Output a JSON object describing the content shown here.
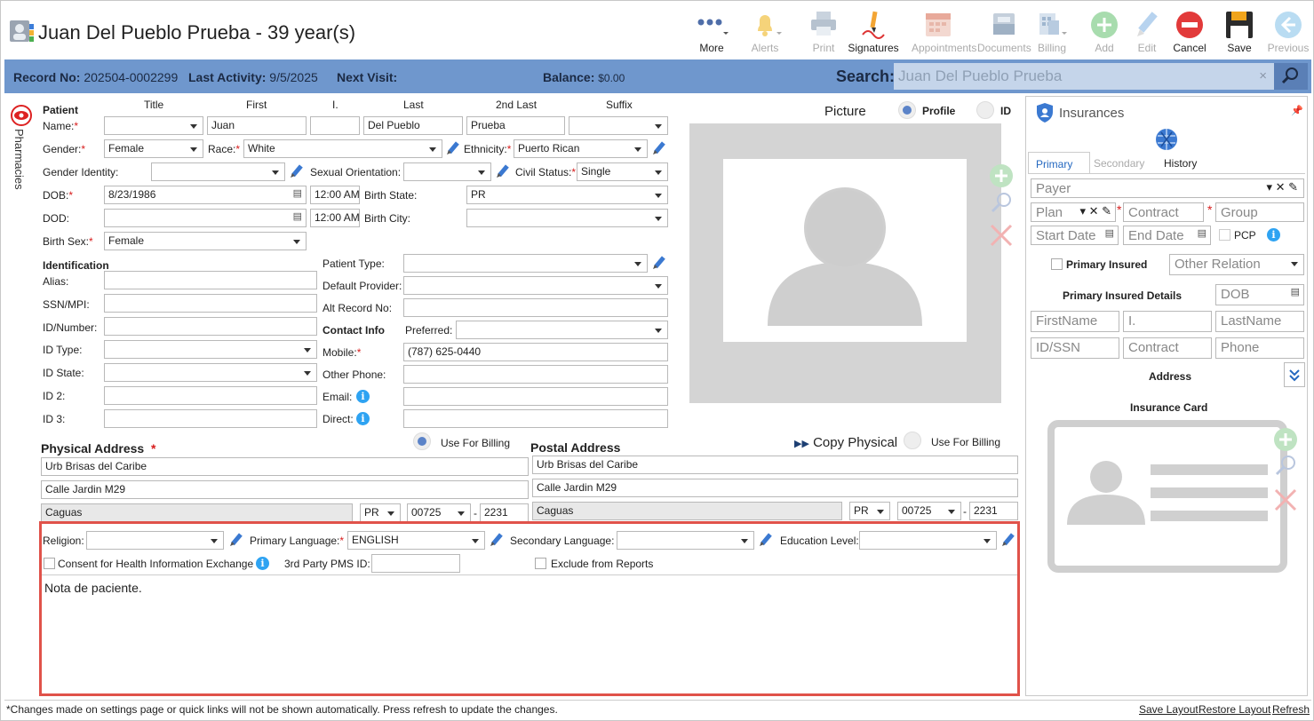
{
  "header": {
    "title": "Juan Del Pueblo Prueba - 39 year(s)"
  },
  "toolbar": {
    "more": "More",
    "alerts": "Alerts",
    "print": "Print",
    "signatures": "Signatures",
    "appointments": "Appointments",
    "documents": "Documents",
    "billing": "Billing",
    "add": "Add",
    "edit": "Edit",
    "cancel": "Cancel",
    "save": "Save",
    "previous": "Previous"
  },
  "record_bar": {
    "record_label": "Record No:",
    "record_value": "202504-0002299",
    "last_activity_label": "Last Activity:",
    "last_activity_value": "9/5/2025",
    "next_visit_label": "Next Visit:",
    "balance_label": "Balance:",
    "balance_value": "$0.00",
    "search_label": "Search:",
    "search_value": "Juan Del Pueblo Prueba"
  },
  "left_tab": {
    "label": "Pharmacies"
  },
  "patient": {
    "section": "Patient",
    "col_title": "Title",
    "col_first": "First",
    "col_i": "I.",
    "col_last": "Last",
    "col_2nd_last": "2nd Last",
    "col_suffix": "Suffix",
    "name_label": "Name:",
    "first": "Juan",
    "middle": "",
    "last": "Del Pueblo",
    "second_last": "Prueba",
    "title": "",
    "suffix": "",
    "gender_label": "Gender:",
    "gender": "Female",
    "race_label": "Race:",
    "race": "White",
    "ethnicity_label": "Ethnicity:",
    "ethnicity": "Puerto Rican",
    "gender_identity_label": "Gender Identity:",
    "gender_identity": "",
    "sexual_orientation_label": "Sexual Orientation:",
    "sexual_orientation": "",
    "civil_status_label": "Civil Status:",
    "civil_status": "Single",
    "dob_label": "DOB:",
    "dob": "8/23/1986",
    "dob_time": "12:00 AM",
    "birth_state_label": "Birth State:",
    "birth_state": "PR",
    "dod_label": "DOD:",
    "dod": "",
    "dod_time": "12:00 AM",
    "birth_city_label": "Birth City:",
    "birth_city": "",
    "birth_sex_label": "Birth Sex:",
    "birth_sex": "Female"
  },
  "identification": {
    "section": "Identification",
    "alias_label": "Alias:",
    "ssn_label": "SSN/MPI:",
    "id_number_label": "ID/Number:",
    "id_type_label": "ID Type:",
    "id_state_label": "ID State:",
    "id2_label": "ID 2:",
    "id3_label": "ID 3:"
  },
  "other": {
    "patient_type_label": "Patient Type:",
    "default_provider_label": "Default Provider:",
    "alt_record_label": "Alt Record No:",
    "contact_info": "Contact Info",
    "preferred_label": "Preferred:",
    "mobile_label": "Mobile:",
    "mobile": "(787) 625-0440",
    "other_phone_label": "Other Phone:",
    "email_label": "Email:",
    "direct_label": "Direct:"
  },
  "picture": {
    "label": "Picture",
    "profile": "Profile",
    "id": "ID"
  },
  "physical_address": {
    "label": "Physical Address",
    "use_billing": "Use For Billing",
    "line1": "Urb Brisas del Caribe",
    "line2": "Calle Jardin M29",
    "city": "Caguas",
    "state": "PR",
    "zip": "00725",
    "zip4": "2231"
  },
  "postal_address": {
    "label": "Postal Address",
    "copy": "Copy Physical",
    "use_billing": "Use For Billing",
    "line1": "Urb Brisas del Caribe",
    "line2": "Calle Jardin M29",
    "city": "Caguas",
    "state": "PR",
    "zip": "00725",
    "zip4": "2231"
  },
  "extra": {
    "religion_label": "Religion:",
    "primary_language_label": "Primary Language:",
    "primary_language": "ENGLISH",
    "secondary_language_label": "Secondary Language:",
    "education_label": "Education Level:",
    "consent_label": "Consent for Health Information Exchange",
    "pms_label": "3rd Party PMS ID:",
    "exclude_label": "Exclude from Reports",
    "note": "Nota de paciente."
  },
  "insurances": {
    "title": "Insurances",
    "tab_primary": "Primary",
    "tab_secondary": "Secondary",
    "tab_history": "History",
    "payer": "Payer",
    "plan": "Plan",
    "contract": "Contract",
    "group": "Group",
    "start_date": "Start Date",
    "end_date": "End Date",
    "pcp": "PCP",
    "primary_insured": "Primary Insured",
    "other_relation": "Other Relation",
    "details": "Primary Insured Details",
    "dob": "DOB",
    "firstname": "FirstName",
    "i": "I.",
    "lastname": "LastName",
    "id_ssn": "ID/SSN",
    "contract2": "Contract",
    "phone": "Phone",
    "address": "Address",
    "card": "Insurance Card"
  },
  "footer": {
    "note": "*Changes made on settings page or quick links will not be shown automatically. Press refresh to update the changes.",
    "save_layout": "Save Layout",
    "restore_layout": "Restore Layout",
    "refresh": "Refresh"
  }
}
